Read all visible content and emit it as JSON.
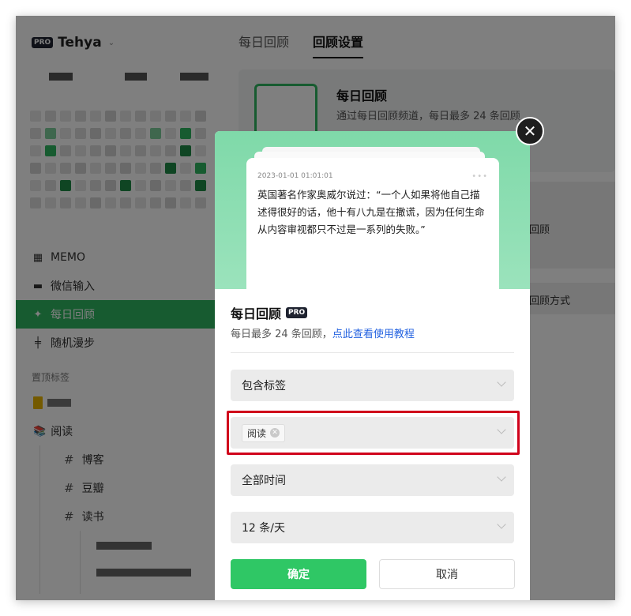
{
  "sidebar": {
    "user": {
      "badge": "PRO",
      "name": "Tehya",
      "chevron": "⌄"
    },
    "nav": [
      {
        "label": "MEMO",
        "icon": "grid-icon"
      },
      {
        "label": "微信输入",
        "icon": "chat-icon"
      },
      {
        "label": "每日回顾",
        "icon": "sparkle-icon",
        "active": true
      },
      {
        "label": "随机漫步",
        "icon": "shuffle-icon"
      }
    ],
    "pinned_title": "置顶标签",
    "tags": [
      {
        "label": "阅读",
        "icon": "books-icon"
      }
    ],
    "sub_tags": [
      "博客",
      "豆瓣",
      "读书"
    ]
  },
  "main": {
    "tabs": [
      "每日回顾",
      "回顾设置"
    ],
    "card": {
      "title": "每日回顾",
      "desc": "通过每日回顾频道，每日最多 24 条回顾"
    },
    "bg_text_1": "回顾",
    "bg_text_2": "回顾方式"
  },
  "modal": {
    "note": {
      "time": "2023-01-01 01:01:01",
      "dots": "•••",
      "text": "英国著名作家奥威尔说过：“一个人如果将他自己描述得很好的话，他十有八九是在撒谎，因为任何生命从内容审视都只不过是一系列的失败。”"
    },
    "title": "每日回顾",
    "badge": "PRO",
    "subtitle": "每日最多 24 条回顾，",
    "link": "点此查看使用教程",
    "selects": {
      "mode": "包含标签",
      "tag_chip": "阅读",
      "time": "全部时间",
      "count": "12 条/天"
    },
    "ok": "确定",
    "cancel": "取消",
    "close": "✕"
  },
  "colors": {
    "accent": "#2fb761",
    "button_green": "#2fc765",
    "link": "#2362e0",
    "highlight": "#d0021b"
  }
}
